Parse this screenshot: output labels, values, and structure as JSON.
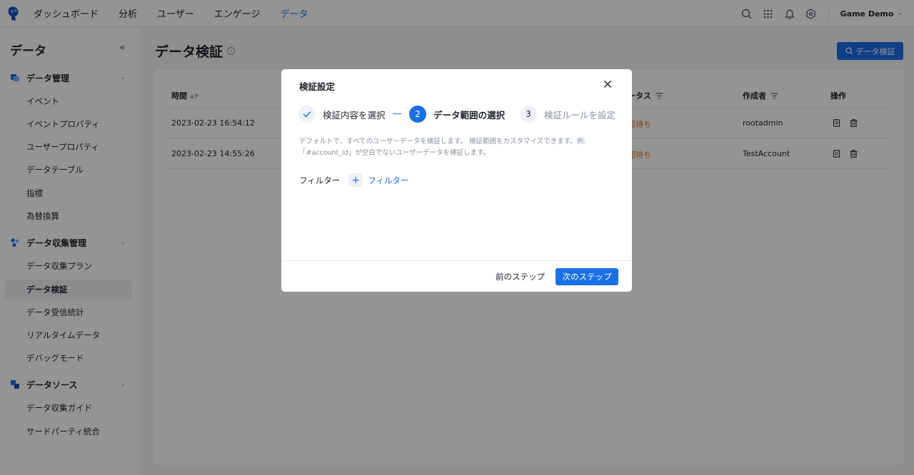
{
  "topnav": {
    "items": [
      {
        "label": "ダッシュボード",
        "active": false
      },
      {
        "label": "分析",
        "active": false
      },
      {
        "label": "ユーザー",
        "active": false
      },
      {
        "label": "エンゲージ",
        "active": false
      },
      {
        "label": "データ",
        "active": true
      }
    ],
    "project_name": "Game Demo",
    "accent": "#1a6fe8"
  },
  "sidebar": {
    "title": "データ",
    "collapse_glyph": "«",
    "groups": [
      {
        "label": "データ管理",
        "icon": "data-management-icon",
        "items": [
          "イベント",
          "イベントプロパティ",
          "ユーザープロパティ",
          "データテーブル",
          "指標",
          "為替換算"
        ]
      },
      {
        "label": "データ収集管理",
        "icon": "data-collection-icon",
        "items": [
          "データ収集プラン",
          "データ検証",
          "データ受信統計",
          "リアルタイムデータ",
          "デバッグモード"
        ]
      },
      {
        "label": "データソース",
        "icon": "data-source-icon",
        "items": [
          "データ収集ガイド",
          "サードパーティ統合"
        ]
      }
    ],
    "active_item": "データ検証"
  },
  "main": {
    "title": "データ検証",
    "primary_button": "データ検証",
    "table": {
      "headers": {
        "time": "時間",
        "status": "ータス",
        "creator": "作成者",
        "actions": "操作"
      },
      "rows": [
        {
          "time": "2023-02-23 16:54:12",
          "status": "認待ち",
          "creator": "rootadmin"
        },
        {
          "time": "2023-02-23 14:55:26",
          "status": "認待ち",
          "creator": "TestAccount"
        }
      ]
    }
  },
  "modal": {
    "title": "検証設定",
    "steps": [
      {
        "index": "",
        "label": "検証内容を選択",
        "state": "done"
      },
      {
        "index": "2",
        "label": "データ範囲の選択",
        "state": "current"
      },
      {
        "index": "3",
        "label": "検証ルールを設定",
        "state": "pending"
      }
    ],
    "description_line1": "デフォルトで、すべてのユーザーデータを検証します。 検証範囲をカスタマイズできます。例:",
    "description_line2": "「#account_id」が空白でないユーザーデータを検証します。",
    "filter_label": "フィルター",
    "filter_add_label": "フィルター",
    "prev_button": "前のステップ",
    "next_button": "次のステップ"
  }
}
